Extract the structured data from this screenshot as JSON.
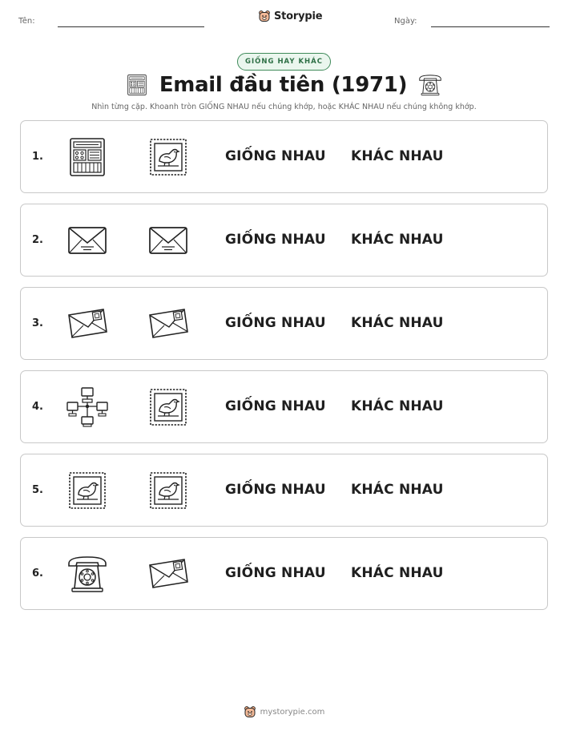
{
  "header": {
    "name_label": "Tên:",
    "date_label": "Ngày:",
    "brand": "Storypie"
  },
  "badge": "GIỐNG HAY KHÁC",
  "title": "Email đầu tiên (1971)",
  "instructions": "Nhìn từng cặp. Khoanh tròn GIỐNG NHAU nếu chúng khớp, hoặc KHÁC NHAU nếu chúng không khớp.",
  "rows": [
    {
      "num": "1.",
      "left": "mainframe-computer",
      "right": "bird-stamp",
      "same": "GIỐNG NHAU",
      "diff": "KHÁC NHAU"
    },
    {
      "num": "2.",
      "left": "envelope",
      "right": "envelope",
      "same": "GIỐNG NHAU",
      "diff": "KHÁC NHAU"
    },
    {
      "num": "3.",
      "left": "stamped-envelope",
      "right": "stamped-envelope",
      "same": "GIỐNG NHAU",
      "diff": "KHÁC NHAU"
    },
    {
      "num": "4.",
      "left": "computer-network",
      "right": "bird-stamp",
      "same": "GIỐNG NHAU",
      "diff": "KHÁC NHAU"
    },
    {
      "num": "5.",
      "left": "bird-stamp",
      "right": "bird-stamp",
      "same": "GIỐNG NHAU",
      "diff": "KHÁC NHAU"
    },
    {
      "num": "6.",
      "left": "rotary-telephone",
      "right": "stamped-envelope",
      "same": "GIỐNG NHAU",
      "diff": "KHÁC NHAU"
    }
  ],
  "title_icons": {
    "left": "mainframe-computer",
    "right": "rotary-telephone"
  },
  "footer": {
    "text": "mystorypie.com"
  },
  "colors": {
    "badge_border": "#3f8a5a",
    "badge_bg": "#eaf6ee",
    "badge_text": "#2d6f45"
  }
}
